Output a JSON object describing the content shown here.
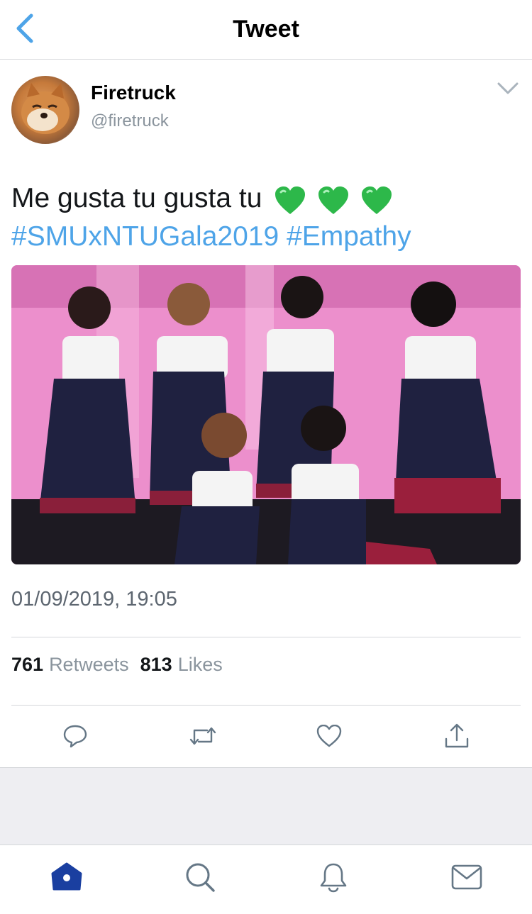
{
  "nav": {
    "title": "Tweet",
    "back_icon": "chevron-left-icon"
  },
  "user": {
    "display_name": "Firetruck",
    "handle": "@firetruck"
  },
  "tweet": {
    "text": "Me gusta tu gusta tu",
    "emoji": "💚💚💚",
    "hashtags": [
      "#SMUxNTUGala2019",
      "#Empathy"
    ],
    "timestamp": "01/09/2019, 19:05"
  },
  "stats": {
    "retweets_count": "761",
    "retweets_label": "Retweets",
    "likes_count": "813",
    "likes_label": "Likes"
  },
  "colors": {
    "accent": "#4ea4e8",
    "heart_green": "#2db84a",
    "tab_active": "#1a3fa0",
    "secondary_text": "#8a949d"
  },
  "tabs": [
    "home-icon",
    "search-icon",
    "bell-icon",
    "mail-icon"
  ]
}
